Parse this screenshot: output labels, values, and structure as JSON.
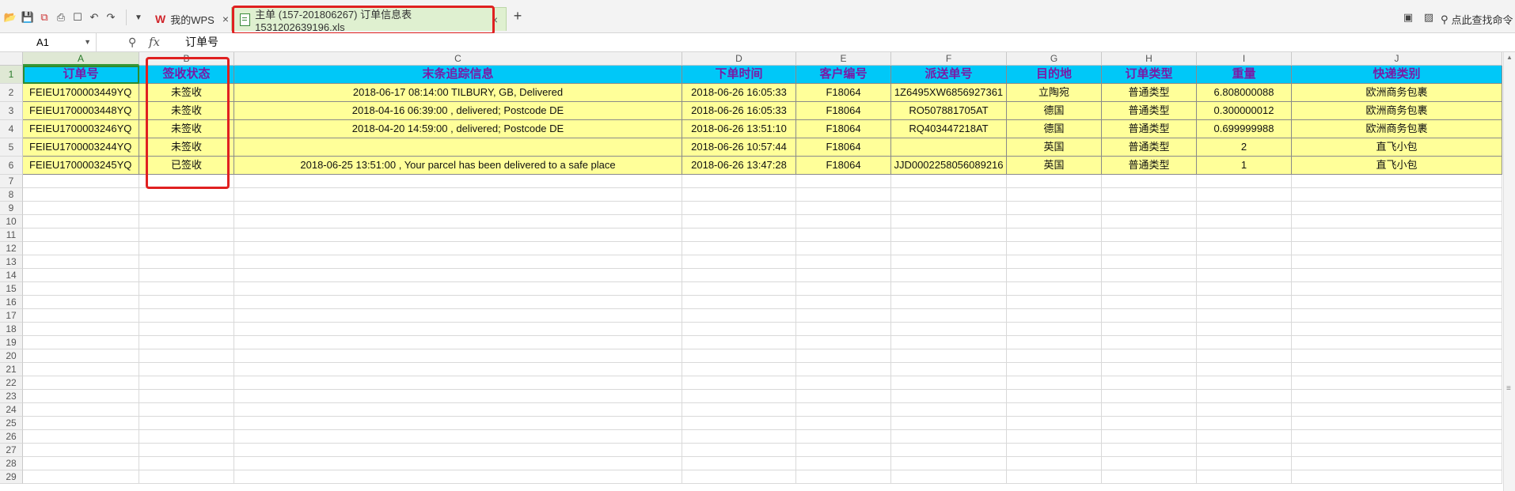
{
  "toolbar": {
    "tabs": [
      {
        "label": "我的WPS"
      },
      {
        "label": "主单 (157-201806267) 订单信息表1531202639196.xls"
      }
    ],
    "new_tab": "+",
    "search_label": "点此查找命令"
  },
  "formula_bar": {
    "name_box": "A1",
    "fx": "fx",
    "content": "订单号"
  },
  "columns": [
    "A",
    "B",
    "C",
    "D",
    "E",
    "F",
    "G",
    "H",
    "I",
    "J"
  ],
  "header_row": [
    "订单号",
    "签收状态",
    "末条追踪信息",
    "下单时间",
    "客户编号",
    "派送单号",
    "目的地",
    "订单类型",
    "重量",
    "快递类别"
  ],
  "rows": [
    [
      "FEIEU1700003449YQ",
      "未签收",
      "2018-06-17 08:14:00 TILBURY, GB, Delivered",
      "2018-06-26 16:05:33",
      "F18064",
      "1Z6495XW6856927361",
      "立陶宛",
      "普通类型",
      "6.808000088",
      "欧洲商务包裹"
    ],
    [
      "FEIEU1700003448YQ",
      "未签收",
      "2018-04-16 06:39:00 , delivered; Postcode DE",
      "2018-06-26 16:05:33",
      "F18064",
      "RO507881705AT",
      "德国",
      "普通类型",
      "0.300000012",
      "欧洲商务包裹"
    ],
    [
      "FEIEU1700003246YQ",
      "未签收",
      "2018-04-20 14:59:00 , delivered; Postcode DE",
      "2018-06-26 13:51:10",
      "F18064",
      "RQ403447218AT",
      "德国",
      "普通类型",
      "0.699999988",
      "欧洲商务包裹"
    ],
    [
      "FEIEU1700003244YQ",
      "未签收",
      "",
      "2018-06-26 10:57:44",
      "F18064",
      "",
      "英国",
      "普通类型",
      "2",
      "直飞小包"
    ],
    [
      "FEIEU1700003245YQ",
      "已签收",
      "2018-06-25 13:51:00 , Your parcel has been delivered to a safe place",
      "2018-06-26 13:47:28",
      "F18064",
      "JJD0002258056089216",
      "英国",
      "普通类型",
      "1",
      "直飞小包"
    ]
  ],
  "row_numbers": [
    "1",
    "2",
    "3",
    "4",
    "5",
    "6",
    "7",
    "8",
    "9",
    "10",
    "11",
    "12",
    "13",
    "14",
    "15",
    "16",
    "17",
    "18",
    "19",
    "20",
    "21",
    "22",
    "23",
    "24",
    "25",
    "26",
    "27",
    "28",
    "29"
  ],
  "colors": {
    "header_fill": "#00c8f8",
    "header_text": "#7a1aa6",
    "data_fill": "#ffff99",
    "highlight_box": "#e02020"
  }
}
